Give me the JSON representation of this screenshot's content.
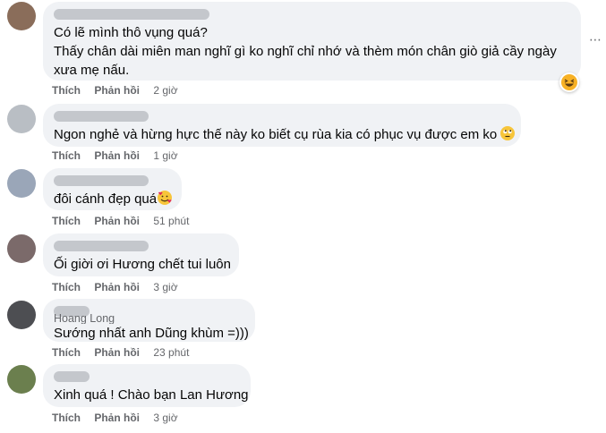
{
  "comments": [
    {
      "lines": [
        "Có lẽ mình thô vụng quá?",
        "Thấy chân dài miên man nghĩ gì ko nghĩ chỉ nhớ và thèm món chân giò giả cầy ngày",
        "xưa mẹ nấu."
      ],
      "like": "Thích",
      "reply": "Phản hồi",
      "time": "2 giờ",
      "reaction": "grinning-squint-emoji"
    },
    {
      "lines": [
        "Ngon nghẻ và hừng hực thế này ko biết cụ rùa kia có phục vụ được em ko"
      ],
      "inline_emoji": "rolling-eyes-emoji",
      "like": "Thích",
      "reply": "Phản hồi",
      "time": "1 giờ"
    },
    {
      "lines": [
        "đôi cánh đẹp quá"
      ],
      "inline_emoji": "smiling-hearts-emoji",
      "like": "Thích",
      "reply": "Phản hồi",
      "time": "51 phút"
    },
    {
      "lines": [
        "Ối giời ơi Hương chết tui luôn"
      ],
      "like": "Thích",
      "reply": "Phản hồi",
      "time": "3 giờ"
    },
    {
      "name": "Hoang Long",
      "lines": [
        "Sướng nhất anh Dũng khùm =)))"
      ],
      "like": "Thích",
      "reply": "Phản hồi",
      "time": "23 phút"
    },
    {
      "lines": [
        "Xinh quá ! Chào bạn Lan Hương"
      ],
      "like": "Thích",
      "reply": "Phản hồi",
      "time": "3 giờ"
    }
  ],
  "more_icon": "more-horizontal-icon",
  "colors": {
    "bubble": "#f0f2f5",
    "meta": "#65676b",
    "text": "#050505"
  }
}
